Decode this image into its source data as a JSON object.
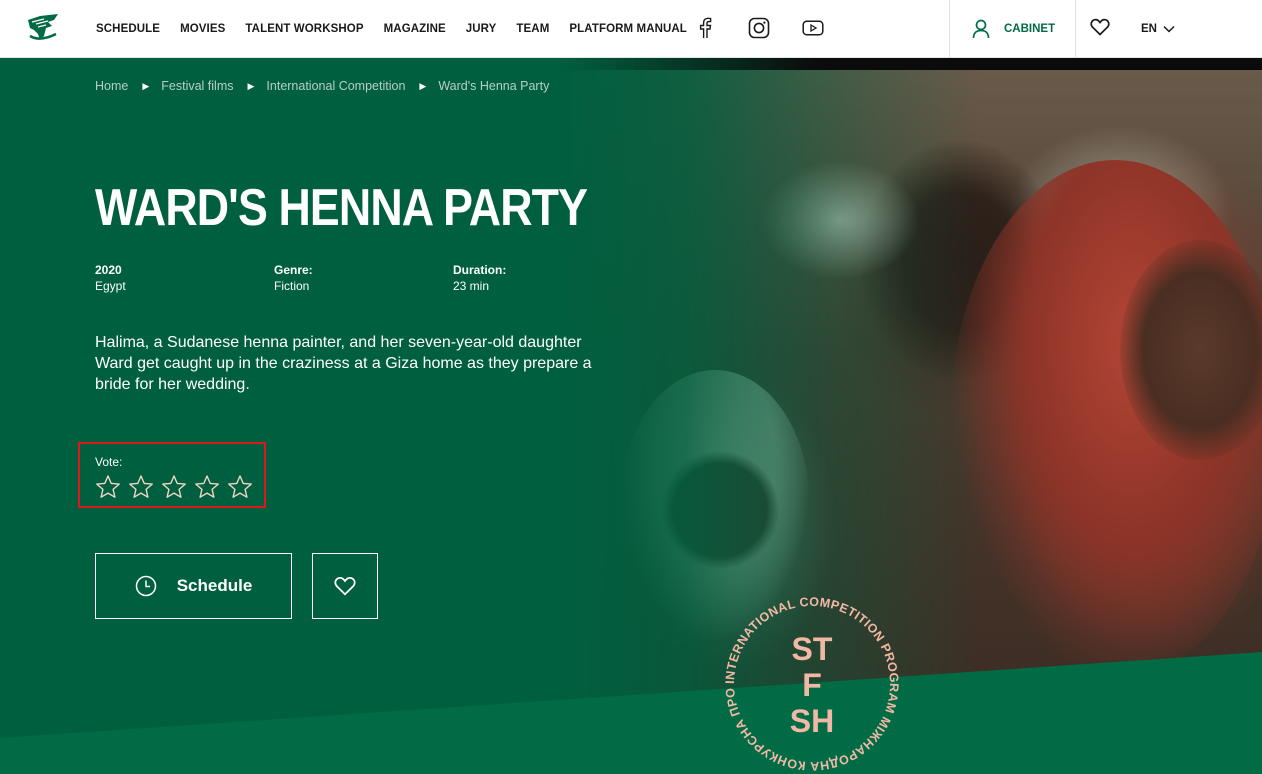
{
  "header": {
    "logo_icon": "deer-logo-icon",
    "nav": [
      "SCHEDULE",
      "MOVIES",
      "TALENT WORKSHOP",
      "MAGAZINE",
      "JURY",
      "TEAM",
      "PLATFORM MANUAL"
    ],
    "socials": [
      "facebook-icon",
      "instagram-icon",
      "youtube-icon"
    ],
    "cabinet_label": "CABINET",
    "language": "EN"
  },
  "breadcrumb": [
    "Home",
    "Festival films",
    "International Competition",
    "Ward's Henna Party"
  ],
  "film": {
    "title": "WARD'S HENNA PARTY",
    "year": "2020",
    "country": "Egypt",
    "genre_label": "Genre:",
    "genre": "Fiction",
    "duration_label": "Duration:",
    "duration": "23 min",
    "description": "Halima, a Sudanese henna painter, and her seven-year-old daughter Ward get caught up in the craziness at a Giza home as they prepare a bride for her wedding."
  },
  "vote": {
    "label": "Vote:",
    "max_stars": 5,
    "rating": 0
  },
  "actions": {
    "schedule_label": "Schedule"
  },
  "badge": {
    "letters": [
      "ST",
      "F",
      "SH"
    ],
    "ring_text": "INTERNATIONAL COMPETITION PROGRAM МІЖНАРОДНА КОНКУРСНА ПРОГРАМА"
  },
  "colors": {
    "brand_green": "#005f3f",
    "accent_green": "#006b45",
    "badge_pink": "#f2b8a6",
    "highlight_red": "#e0161c"
  }
}
